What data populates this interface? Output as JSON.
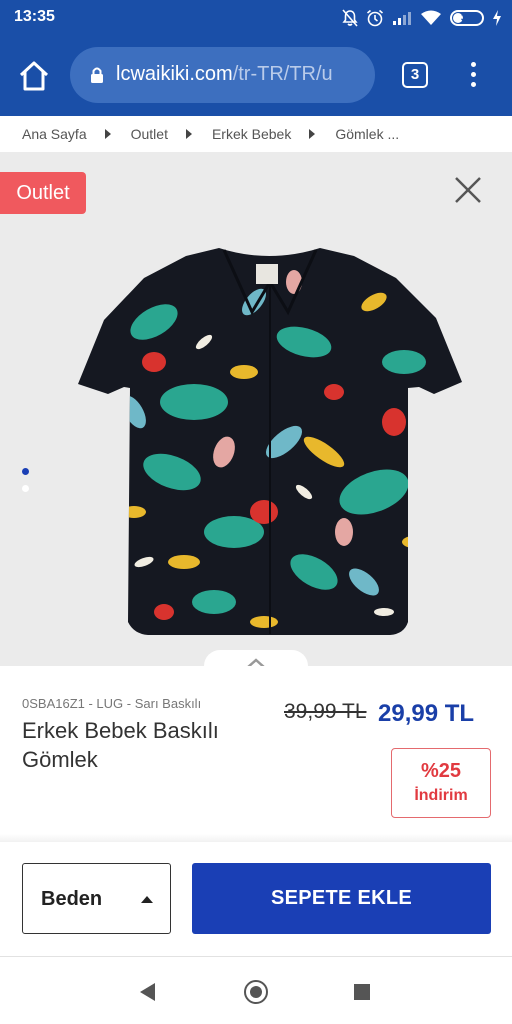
{
  "status_bar": {
    "time": "13:35",
    "battery_level": "34"
  },
  "browser": {
    "url_host": "lcwaikiki.com",
    "url_path": "/tr-TR/TR/u",
    "tab_count": "3"
  },
  "breadcrumb": [
    "Ana Sayfa",
    "Outlet",
    "Erkek Bebek",
    "Gömlek ..."
  ],
  "gallery": {
    "badge": "Outlet",
    "active_slide": 1,
    "slide_count": 2
  },
  "product": {
    "sku": "0SBA16Z1 - LUG - Sarı Baskılı",
    "title": "Erkek Bebek Baskılı Gömlek",
    "old_price": "39,99 TL",
    "new_price": "29,99 TL",
    "discount_percent": "%25",
    "discount_label": "İndirim"
  },
  "actions": {
    "size_label": "Beden",
    "add_to_cart_label": "SEPETE EKLE"
  },
  "colors": {
    "brand_blue": "#1a4fa8",
    "price_blue": "#1a3fa8",
    "badge_red": "#f0595e",
    "discount_red": "#e13a40"
  },
  "icons": [
    "home-icon",
    "lock-icon",
    "tabs-icon",
    "more-vert-icon",
    "close-icon",
    "chevron-up-icon",
    "caret-up-icon",
    "back-icon",
    "home-circle-icon",
    "recents-icon"
  ]
}
